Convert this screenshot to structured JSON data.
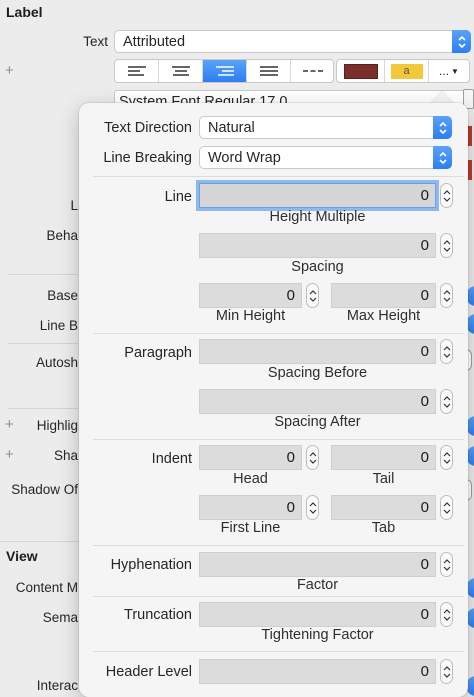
{
  "background": {
    "label_section": {
      "title": "Label",
      "text_label": "Text",
      "text_value": "Attributed",
      "font_value": "System Font Regular 17.0",
      "overflow_button": "...",
      "highlight_swatch_text": "a",
      "truncated_labels": [
        "L",
        "Beha",
        "Base",
        "Line B",
        "Autosh",
        "Highlig",
        "Sha",
        "Shadow Of"
      ]
    },
    "view_section": {
      "title": "View",
      "truncated_labels": [
        "Content M",
        "Sema",
        "Interac"
      ]
    },
    "colors": {
      "accent_blue": "#2c7ef2",
      "text_color_swatch": "#7a2f2a",
      "highlight_swatch": "#f2c93b"
    }
  },
  "popover": {
    "text_direction": {
      "label": "Text Direction",
      "value": "Natural"
    },
    "line_breaking": {
      "label": "Line Breaking",
      "value": "Word Wrap"
    },
    "line": {
      "label": "Line",
      "height_multiple": {
        "value": "0",
        "caption": "Height Multiple"
      },
      "spacing": {
        "value": "0",
        "caption": "Spacing"
      },
      "min_height": {
        "value": "0",
        "caption": "Min Height"
      },
      "max_height": {
        "value": "0",
        "caption": "Max Height"
      }
    },
    "paragraph": {
      "label": "Paragraph",
      "spacing_before": {
        "value": "0",
        "caption": "Spacing Before"
      },
      "spacing_after": {
        "value": "0",
        "caption": "Spacing After"
      }
    },
    "indent": {
      "label": "Indent",
      "head": {
        "value": "0",
        "caption": "Head"
      },
      "tail": {
        "value": "0",
        "caption": "Tail"
      },
      "first_line": {
        "value": "0",
        "caption": "First Line"
      },
      "tab": {
        "value": "0",
        "caption": "Tab"
      }
    },
    "hyphenation": {
      "label": "Hyphenation",
      "value": "0",
      "caption": "Factor"
    },
    "truncation": {
      "label": "Truncation",
      "value": "0",
      "caption": "Tightening Factor"
    },
    "header_level": {
      "label": "Header Level",
      "value": "0"
    }
  }
}
